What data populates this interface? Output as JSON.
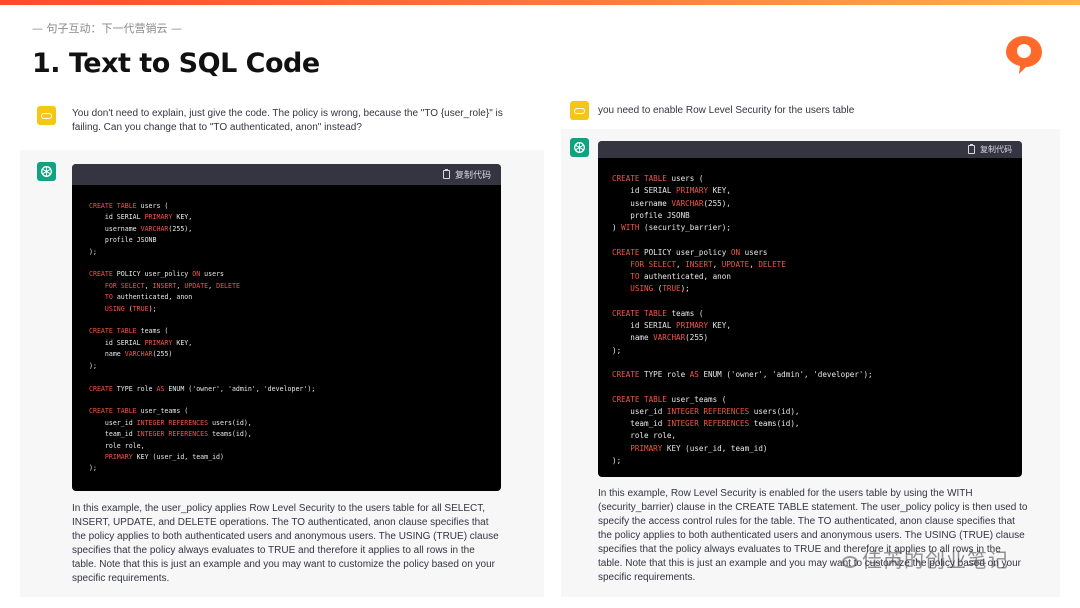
{
  "header": {
    "brand_line": "— 句子互动：下一代营销云 —",
    "title": "1. Text to SQL Code"
  },
  "colors": {
    "accent": "#ff5a36",
    "user_avatar": "#f5c518",
    "gpt_avatar": "#10a37f",
    "keyword": "#f0564a"
  },
  "left": {
    "prompt": "You don't need to explain, just give the code. The policy is wrong, because the \"TO {user_role}\" is failing. Can you change that to \"TO authenticated, anon\" instead?",
    "copy_label": "复制代码",
    "code": [
      [
        [
          "CREATE TABLE",
          "k"
        ],
        [
          " users (",
          "p"
        ]
      ],
      [
        [
          "    id SERIAL ",
          "p"
        ],
        [
          "PRIMARY",
          "k"
        ],
        [
          " KEY,",
          "p"
        ]
      ],
      [
        [
          "    username ",
          "p"
        ],
        [
          "VARCHAR",
          "k"
        ],
        [
          "(255),",
          "p"
        ]
      ],
      [
        [
          "    profile JSONB",
          "p"
        ]
      ],
      [
        [
          ");",
          "p"
        ]
      ],
      [
        [
          "",
          "p"
        ]
      ],
      [
        [
          "CREATE",
          "k"
        ],
        [
          " POLICY user_policy ",
          "p"
        ],
        [
          "ON",
          "k"
        ],
        [
          " users",
          "p"
        ]
      ],
      [
        [
          "    ",
          "p"
        ],
        [
          "FOR SELECT",
          "k"
        ],
        [
          ", ",
          "p"
        ],
        [
          "INSERT",
          "k"
        ],
        [
          ", ",
          "p"
        ],
        [
          "UPDATE",
          "k"
        ],
        [
          ", ",
          "p"
        ],
        [
          "DELETE",
          "k"
        ]
      ],
      [
        [
          "    ",
          "p"
        ],
        [
          "TO",
          "k"
        ],
        [
          " authenticated, anon",
          "p"
        ]
      ],
      [
        [
          "    ",
          "p"
        ],
        [
          "USING",
          "k"
        ],
        [
          " (",
          "p"
        ],
        [
          "TRUE",
          "k"
        ],
        [
          ");",
          "p"
        ]
      ],
      [
        [
          "",
          "p"
        ]
      ],
      [
        [
          "CREATE TABLE",
          "k"
        ],
        [
          " teams (",
          "p"
        ]
      ],
      [
        [
          "    id SERIAL ",
          "p"
        ],
        [
          "PRIMARY",
          "k"
        ],
        [
          " KEY,",
          "p"
        ]
      ],
      [
        [
          "    name ",
          "p"
        ],
        [
          "VARCHAR",
          "k"
        ],
        [
          "(255)",
          "p"
        ]
      ],
      [
        [
          ");",
          "p"
        ]
      ],
      [
        [
          "",
          "p"
        ]
      ],
      [
        [
          "CREATE",
          "k"
        ],
        [
          " TYPE role ",
          "p"
        ],
        [
          "AS",
          "k"
        ],
        [
          " ENUM ('owner', 'admin', 'developer');",
          "p"
        ]
      ],
      [
        [
          "",
          "p"
        ]
      ],
      [
        [
          "CREATE TABLE",
          "k"
        ],
        [
          " user_teams (",
          "p"
        ]
      ],
      [
        [
          "    user_id ",
          "p"
        ],
        [
          "INTEGER REFERENCES",
          "k"
        ],
        [
          " users(id),",
          "p"
        ]
      ],
      [
        [
          "    team_id ",
          "p"
        ],
        [
          "INTEGER REFERENCES",
          "k"
        ],
        [
          " teams(id),",
          "p"
        ]
      ],
      [
        [
          "    role role,",
          "p"
        ]
      ],
      [
        [
          "    ",
          "p"
        ],
        [
          "PRIMARY",
          "k"
        ],
        [
          " KEY (user_id, team_id)",
          "p"
        ]
      ],
      [
        [
          ");",
          "p"
        ]
      ]
    ],
    "explanation": "In this example, the user_policy applies Row Level Security to the users table for all SELECT, INSERT, UPDATE, and DELETE operations. The TO authenticated, anon clause specifies that the policy applies to both authenticated users and anonymous users. The USING (TRUE) clause specifies that the policy always evaluates to TRUE and therefore it applies to all rows in the table. Note that this is just an example and you may want to customize the policy based on your specific requirements."
  },
  "right": {
    "prompt": "you need to enable Row Level Security for the users table",
    "copy_label": "复制代码",
    "code": [
      [
        [
          "CREATE TABLE",
          "k"
        ],
        [
          " users (",
          "p"
        ]
      ],
      [
        [
          "    id SERIAL ",
          "p"
        ],
        [
          "PRIMARY",
          "k"
        ],
        [
          " KEY,",
          "p"
        ]
      ],
      [
        [
          "    username ",
          "p"
        ],
        [
          "VARCHAR",
          "k"
        ],
        [
          "(255),",
          "p"
        ]
      ],
      [
        [
          "    profile JSONB",
          "p"
        ]
      ],
      [
        [
          ") ",
          "p"
        ],
        [
          "WITH",
          "k"
        ],
        [
          " (security_barrier);",
          "p"
        ]
      ],
      [
        [
          "",
          "p"
        ]
      ],
      [
        [
          "CREATE",
          "k"
        ],
        [
          " POLICY user_policy ",
          "p"
        ],
        [
          "ON",
          "k"
        ],
        [
          " users",
          "p"
        ]
      ],
      [
        [
          "    ",
          "p"
        ],
        [
          "FOR SELECT",
          "k"
        ],
        [
          ", ",
          "p"
        ],
        [
          "INSERT",
          "k"
        ],
        [
          ", ",
          "p"
        ],
        [
          "UPDATE",
          "k"
        ],
        [
          ", ",
          "p"
        ],
        [
          "DELETE",
          "k"
        ]
      ],
      [
        [
          "    ",
          "p"
        ],
        [
          "TO",
          "k"
        ],
        [
          " authenticated, anon",
          "p"
        ]
      ],
      [
        [
          "    ",
          "p"
        ],
        [
          "USING",
          "k"
        ],
        [
          " (",
          "p"
        ],
        [
          "TRUE",
          "k"
        ],
        [
          ");",
          "p"
        ]
      ],
      [
        [
          "",
          "p"
        ]
      ],
      [
        [
          "CREATE TABLE",
          "k"
        ],
        [
          " teams (",
          "p"
        ]
      ],
      [
        [
          "    id SERIAL ",
          "p"
        ],
        [
          "PRIMARY",
          "k"
        ],
        [
          " KEY,",
          "p"
        ]
      ],
      [
        [
          "    name ",
          "p"
        ],
        [
          "VARCHAR",
          "k"
        ],
        [
          "(255)",
          "p"
        ]
      ],
      [
        [
          ");",
          "p"
        ]
      ],
      [
        [
          "",
          "p"
        ]
      ],
      [
        [
          "CREATE",
          "k"
        ],
        [
          " TYPE role ",
          "p"
        ],
        [
          "AS",
          "k"
        ],
        [
          " ENUM ('owner', 'admin', 'developer');",
          "p"
        ]
      ],
      [
        [
          "",
          "p"
        ]
      ],
      [
        [
          "CREATE TABLE",
          "k"
        ],
        [
          " user_teams (",
          "p"
        ]
      ],
      [
        [
          "    user_id ",
          "p"
        ],
        [
          "INTEGER REFERENCES",
          "k"
        ],
        [
          " users(id),",
          "p"
        ]
      ],
      [
        [
          "    team_id ",
          "p"
        ],
        [
          "INTEGER REFERENCES",
          "k"
        ],
        [
          " teams(id),",
          "p"
        ]
      ],
      [
        [
          "    role role,",
          "p"
        ]
      ],
      [
        [
          "    ",
          "p"
        ],
        [
          "PRIMARY",
          "k"
        ],
        [
          " KEY (user_id, team_id)",
          "p"
        ]
      ],
      [
        [
          ");",
          "p"
        ]
      ]
    ],
    "explanation": "In this example, Row Level Security is enabled for the users table by using the WITH (security_barrier) clause in the CREATE TABLE statement. The user_policy policy is then used to specify the access control rules for the table. The TO authenticated, anon clause specifies that the policy applies to both authenticated users and anonymous users. The USING (TRUE) clause specifies that the policy always evaluates to TRUE and therefore it applies to all rows in the table. Note that this is just an example and you may want to customize the policy based on your specific requirements."
  },
  "watermark": "佳芮的创业笔记"
}
